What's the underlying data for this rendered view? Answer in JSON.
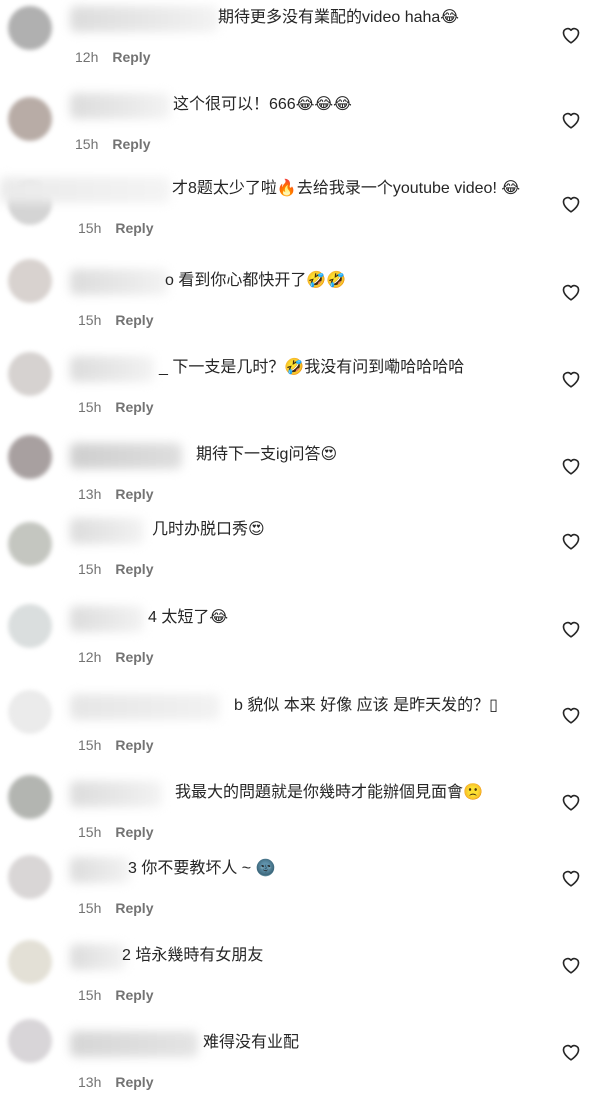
{
  "reply_label": "Reply",
  "comments": [
    {
      "text": "期待更多没有業配的video haha😂",
      "time": "12h"
    },
    {
      "text": "这个很可以！666😂😂😂",
      "time": "15h"
    },
    {
      "text": "才8题太少了啦🔥去给我录一个youtube video! 😂",
      "time": "15h"
    },
    {
      "text": "o 看到你心都快开了🤣🤣",
      "time": "15h"
    },
    {
      "text": "_ 下一支是几时？🤣我没有问到嘞哈哈哈哈",
      "time": "15h"
    },
    {
      "text": "期待下一支ig问答😍",
      "time": "13h"
    },
    {
      "text": "几时办脱口秀😍",
      "time": "15h"
    },
    {
      "text": "4 太短了😂",
      "time": "12h"
    },
    {
      "text": "b 貌似 本来 好像 应该 是昨天发的？▯",
      "time": "15h"
    },
    {
      "text": "我最大的問題就是你幾時才能辦個見面會🙁",
      "time": "15h"
    },
    {
      "text": "3 你不要教坏人 ~ 🌚",
      "time": "15h"
    },
    {
      "text": "2 培永幾時有女朋友",
      "time": "15h"
    },
    {
      "text": "难得没有业配",
      "time": "13h"
    }
  ],
  "icons": {
    "like": "heart-outline-icon"
  }
}
